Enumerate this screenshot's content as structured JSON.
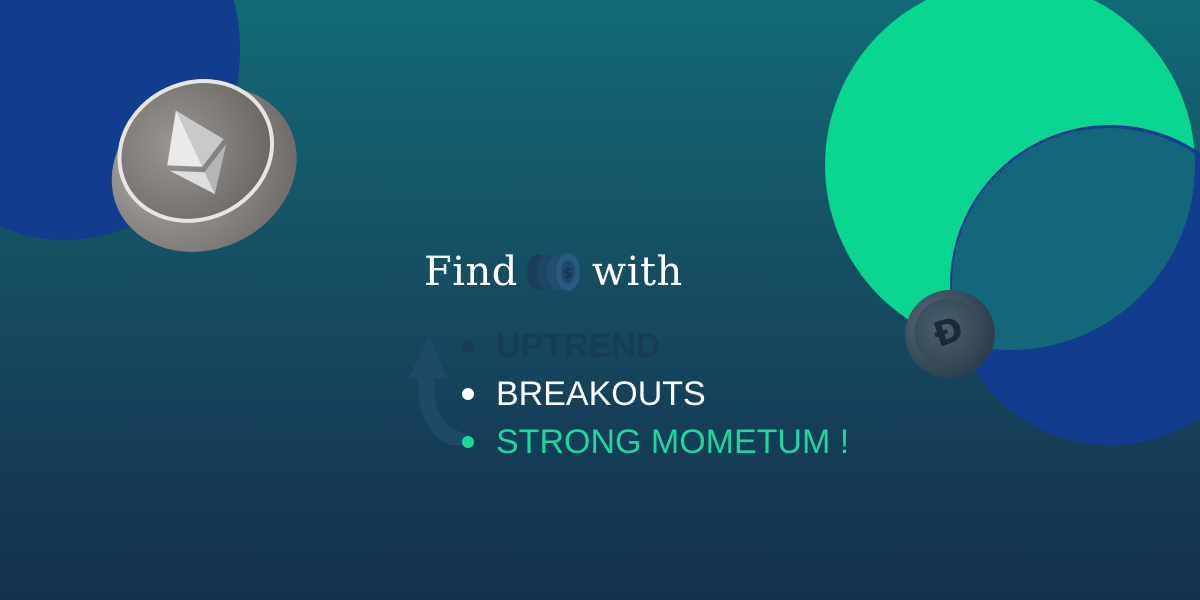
{
  "heading": {
    "word_before": "Find",
    "word_after": "with",
    "inline_icon": "coins-stack-icon"
  },
  "features": [
    {
      "label": "UPTREND",
      "color": "#183c58"
    },
    {
      "label": "BREAKOUTS",
      "color": "#ffffff"
    },
    {
      "label": "STRONG MOMETUM !",
      "color": "#1ed79a"
    }
  ],
  "decor": {
    "background_top": "#126a78",
    "background_bottom": "#15304b",
    "accent_green": "#0ad591",
    "accent_blue": "#123d8f",
    "left_coin_icon": "ethereum-coin-icon",
    "right_coin_icon": "dash-coin-icon",
    "arrow_icon": "up-arrow-icon"
  }
}
